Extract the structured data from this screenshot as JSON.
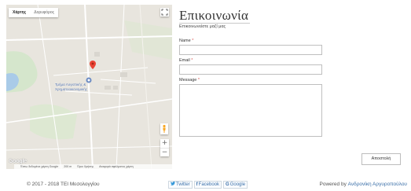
{
  "map": {
    "type_options": [
      "Χάρτης",
      "Δορυφόρος"
    ],
    "place_label": "Τμήμα Λογιστικής & Χρηματοοικονομικής",
    "zoom_in": "+",
    "zoom_out": "−",
    "logo": "Google",
    "footer": [
      "Έστω δεδομένα χάρτη Google",
      "200 m",
      "Όροι Χρήσης",
      "Αναφορά σφάλματος χάρτη"
    ]
  },
  "contact": {
    "title": "Επικοινωνία",
    "subtitle": "Επικοινωνείστε μαζί μας",
    "name_label": "Name",
    "email_label": "Email",
    "message_label": "Message",
    "required_mark": "*",
    "submit_label": "Αποστολή"
  },
  "footer": {
    "copyright": "© 2017 - 2018 ΤΕΙ Μεσολογγίου",
    "social": [
      {
        "icon": "twitter-icon",
        "glyph": "🐦",
        "label": "Twitter"
      },
      {
        "icon": "facebook-icon",
        "glyph": "f",
        "label": "Facebook"
      },
      {
        "icon": "google-icon",
        "glyph": "G",
        "label": "Google"
      }
    ],
    "powered_prefix": "Powered by",
    "powered_author": "Ανδρονίκη Αργυροπούλου"
  },
  "colors": {
    "accent": "#3a6fa8",
    "required": "#d9534f",
    "map_background": "#e9e6df",
    "pin": "#ea4335"
  }
}
